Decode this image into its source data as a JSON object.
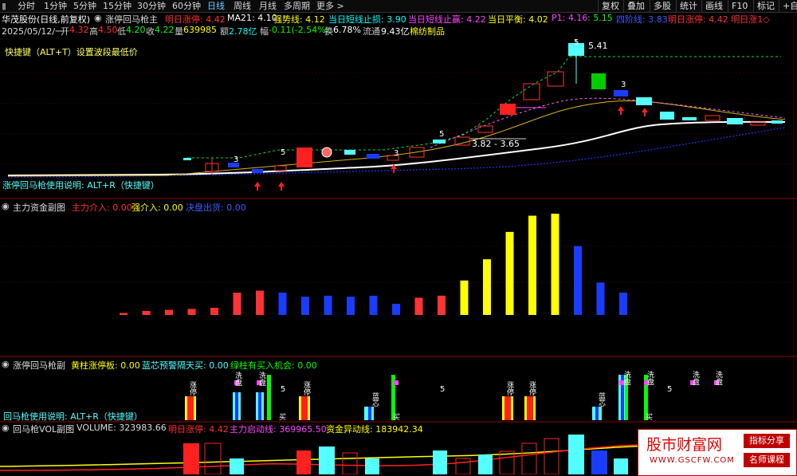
{
  "toolbar": {
    "left_tabs": [
      "分时",
      "1分钟",
      "5分钟",
      "15分钟",
      "30分钟",
      "60分钟",
      "日线",
      "周线",
      "月线",
      "多周期",
      "更多 >"
    ],
    "active_tab": "日线",
    "right_buttons": [
      "复权",
      "叠加",
      "多股",
      "统计",
      "画线",
      "F10",
      "标记",
      "+自"
    ]
  },
  "header": {
    "stock": "华茂股份(日线,前复权)",
    "indicator": "涨停回马枪主",
    "limit_up_label": "明日涨停: 4.42",
    "ma21": "MA21: 4.10",
    "strong_line": "强势线: 4.12",
    "stop_loss": "当日短线止损: 3.90",
    "take_profit": "当日短线止赢: 4.22",
    "balance": "当日平衡: 4.02",
    "p1": "P1: 4.16",
    "p1_val": ": 5.15",
    "fourth_line": "四阶线: 3.83",
    "tail": "明日涨停: 4.42 明日涨1◇"
  },
  "quote": {
    "date": "2025/05/12/一",
    "open_label": "开",
    "open": "4.32",
    "high_label": "高",
    "high": "4.50",
    "low_label": "低",
    "low": "4.20",
    "close_label": "收",
    "close": "4.22",
    "vol_label": "量",
    "vol": "639985",
    "amount_label": "额",
    "amount": "2.78亿",
    "chg_label": "幅",
    "chg": "-0.11(-2.54%)",
    "turnover_label": "换",
    "turnover": "6.78%",
    "float_label": "流通",
    "float": "9.43亿",
    "sector": "棉纺制品"
  },
  "main_chart": {
    "hint": "快捷键（ALT+T）设置波段最低价",
    "usage": "涨停回马枪使用说明: ALT+R（快捷键）",
    "peak_label": "5.41",
    "range_label": "3.82 - 3.65",
    "marker_texts": [
      "5",
      "3",
      "3",
      "5",
      "3",
      "5"
    ]
  },
  "pane2": {
    "title": "主力资金副图",
    "main_in": "主力介入: 0.00",
    "strong_in": "强介入: 0.00",
    "exit": "决盘出货: 0.00",
    "bar_levels": [
      0.02,
      0.04,
      0.05,
      0.06,
      0.07,
      0.22,
      0.24,
      0.22,
      0.18,
      0.19,
      0.18,
      0.19,
      0.11,
      0.17,
      0.19,
      0.34,
      0.55,
      0.82,
      0.98,
      1.0,
      0.68,
      0.32,
      0.22
    ],
    "bar_colors": [
      "red",
      "red",
      "red",
      "red",
      "red",
      "red",
      "red",
      "blue",
      "blue",
      "blue",
      "blue",
      "blue",
      "blue",
      "red",
      "red",
      "yellow",
      "yellow",
      "yellow",
      "yellow",
      "yellow",
      "blue",
      "blue",
      "blue"
    ]
  },
  "pane3": {
    "title": "涨停回马枪副",
    "yellow_label": "黄柱涨停板: 0.00",
    "blue_label": "蓝芯预警隔天买: 0.00",
    "green_label": "绿柱有买入机会: 0.00",
    "usage": "回马枪使用说明: ALT+R（快捷键）",
    "tags": [
      "涨停",
      "洗盘",
      "洗盘",
      "涨停",
      "蓝芯",
      "涨停",
      "涨停",
      "蓝芯",
      "洗盘",
      "洗盘",
      "洗盘",
      "洗盘"
    ],
    "buy": "买",
    "five": "5"
  },
  "pane4": {
    "title": "回马枪VOL副图",
    "volume": "VOLUME: 323983.66",
    "limit_up": "明日涨停: 4.42",
    "main_start": "主力启动线: 369965.50",
    "fund": "资金异动线: 183942.34"
  },
  "watermark": {
    "site": "股市财富网",
    "url": "WWW.GSCFW.COM",
    "btn1": "指标分享",
    "btn2": "名师课程"
  },
  "colors": {
    "red": "#ff3333",
    "yellow": "#ffff00",
    "blue": "#1a3cff",
    "cyan": "#54ffff",
    "magenta": "#ff44ff",
    "green": "#00ff00",
    "white": "#ffffff"
  }
}
